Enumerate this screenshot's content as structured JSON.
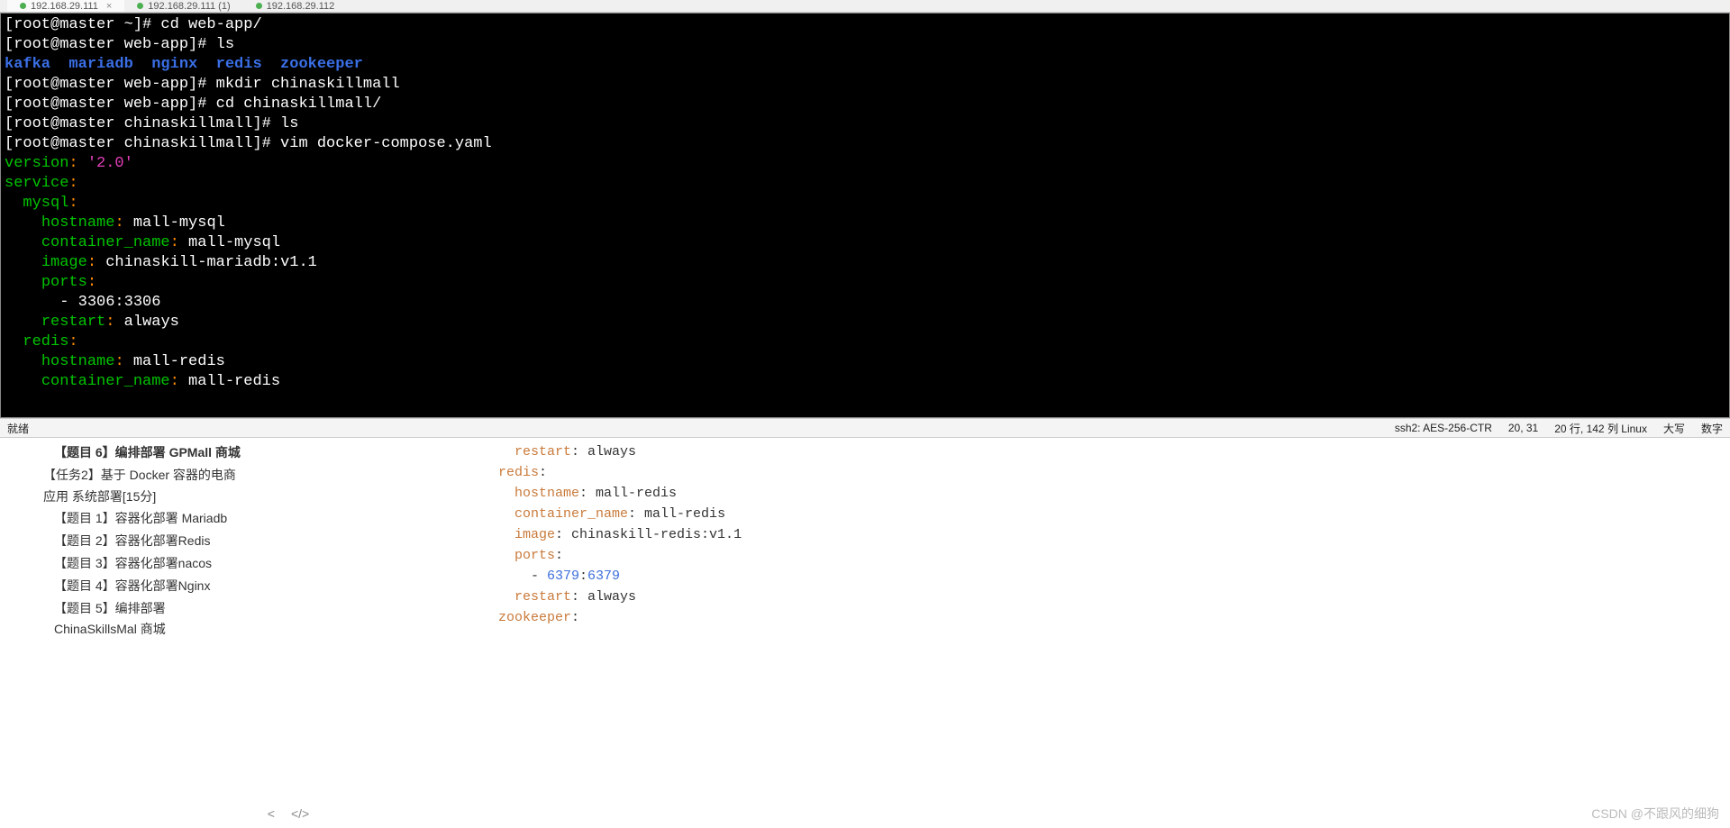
{
  "tabs": [
    {
      "label": "192.168.29.111",
      "active": true,
      "has_close": true,
      "suffix": ""
    },
    {
      "label": "192.168.29.111 (1)",
      "active": false,
      "has_close": false,
      "suffix": ""
    },
    {
      "label": "192.168.29.112",
      "active": false,
      "has_close": false,
      "suffix": ""
    }
  ],
  "terminal_lines": [
    {
      "segs": [
        {
          "c": "t-white",
          "t": "[root@master ~]# cd web-app/"
        }
      ]
    },
    {
      "segs": [
        {
          "c": "t-white",
          "t": "[root@master web-app]# ls"
        }
      ]
    },
    {
      "segs": [
        {
          "c": "t-blue",
          "t": "kafka  mariadb  nginx  redis  zookeeper"
        }
      ]
    },
    {
      "segs": [
        {
          "c": "t-white",
          "t": "[root@master web-app]# mkdir chinaskillmall"
        }
      ]
    },
    {
      "segs": [
        {
          "c": "t-white",
          "t": "[root@master web-app]# cd chinaskillmall/"
        }
      ]
    },
    {
      "segs": [
        {
          "c": "t-white",
          "t": "[root@master chinaskillmall]# ls"
        }
      ]
    },
    {
      "segs": [
        {
          "c": "t-white",
          "t": "[root@master chinaskillmall]# vim docker-compose.yaml"
        }
      ]
    },
    {
      "segs": [
        {
          "c": "t-green",
          "t": "version"
        },
        {
          "c": "t-orange",
          "t": ": "
        },
        {
          "c": "t-magenta",
          "t": "'2.0'"
        }
      ]
    },
    {
      "segs": [
        {
          "c": "t-green",
          "t": "service"
        },
        {
          "c": "t-orange",
          "t": ":"
        }
      ]
    },
    {
      "segs": [
        {
          "c": "t-white",
          "t": "  "
        },
        {
          "c": "t-green",
          "t": "mysql"
        },
        {
          "c": "t-orange",
          "t": ":"
        }
      ]
    },
    {
      "segs": [
        {
          "c": "t-white",
          "t": "    "
        },
        {
          "c": "t-green",
          "t": "hostname"
        },
        {
          "c": "t-orange",
          "t": ":"
        },
        {
          "c": "t-white",
          "t": " mall-mysql"
        }
      ]
    },
    {
      "segs": [
        {
          "c": "t-white",
          "t": "    "
        },
        {
          "c": "t-green",
          "t": "container_name"
        },
        {
          "c": "t-orange",
          "t": ":"
        },
        {
          "c": "t-white",
          "t": " mall-mysql"
        }
      ]
    },
    {
      "segs": [
        {
          "c": "t-white",
          "t": "    "
        },
        {
          "c": "t-green",
          "t": "image"
        },
        {
          "c": "t-orange",
          "t": ":"
        },
        {
          "c": "t-white",
          "t": " chinaskill-mariadb:v1.1"
        }
      ]
    },
    {
      "segs": [
        {
          "c": "t-white",
          "t": "    "
        },
        {
          "c": "t-green",
          "t": "ports"
        },
        {
          "c": "t-orange",
          "t": ":"
        }
      ]
    },
    {
      "segs": [
        {
          "c": "t-white",
          "t": "      - 3306:3306"
        }
      ]
    },
    {
      "segs": [
        {
          "c": "t-white",
          "t": "    "
        },
        {
          "c": "t-green",
          "t": "restart"
        },
        {
          "c": "t-orange",
          "t": ":"
        },
        {
          "c": "t-white",
          "t": " always"
        }
      ]
    },
    {
      "segs": [
        {
          "c": "t-white",
          "t": ""
        }
      ]
    },
    {
      "segs": [
        {
          "c": "t-white",
          "t": "  "
        },
        {
          "c": "t-green",
          "t": "redis"
        },
        {
          "c": "t-orange",
          "t": ":"
        }
      ]
    },
    {
      "segs": [
        {
          "c": "t-white",
          "t": "    "
        },
        {
          "c": "t-green",
          "t": "hostname"
        },
        {
          "c": "t-orange",
          "t": ":"
        },
        {
          "c": "t-white",
          "t": " mall-redis"
        }
      ]
    },
    {
      "segs": [
        {
          "c": "t-white",
          "t": "    "
        },
        {
          "c": "t-green",
          "t": "container_name"
        },
        {
          "c": "t-orange",
          "t": ":"
        },
        {
          "c": "t-white",
          "t": " mall-redis"
        }
      ]
    }
  ],
  "status": {
    "left": "就绪",
    "ssh": "ssh2: AES-256-CTR",
    "pos": "20, 31",
    "size": "20 行, 142 列 ",
    "os": "Linux",
    "caps": "大写",
    "num": "数字"
  },
  "sidebar": [
    {
      "label": "【题目 6】编排部署 GPMall 商城",
      "indent": "indent2",
      "active": true
    },
    {
      "label": "【任务2】基于 Docker 容器的电商应用 系统部署[15分]",
      "indent": "indent1",
      "active": false
    },
    {
      "label": "【题目 1】容器化部署 Mariadb",
      "indent": "indent2",
      "active": false
    },
    {
      "label": "【题目 2】容器化部署Redis",
      "indent": "indent2",
      "active": false
    },
    {
      "label": "【题目 3】容器化部署nacos",
      "indent": "indent2",
      "active": false
    },
    {
      "label": "【题目 4】容器化部署Nginx",
      "indent": "indent2",
      "active": false
    },
    {
      "label": "【题目 5】编排部署 ChinaSkillsMal 商城",
      "indent": "indent2",
      "active": false
    }
  ],
  "gutter": {
    "left": "<",
    "right": ">",
    "code": "</>"
  },
  "content_lines": [
    {
      "segs": [
        {
          "c": "",
          "t": "    "
        },
        {
          "c": "c-orange",
          "t": "restart"
        },
        {
          "c": "",
          "t": ": always"
        }
      ]
    },
    {
      "segs": [
        {
          "c": "",
          "t": ""
        }
      ]
    },
    {
      "segs": [
        {
          "c": "",
          "t": "  "
        },
        {
          "c": "c-orange",
          "t": "redis"
        },
        {
          "c": "",
          "t": ":"
        }
      ]
    },
    {
      "segs": [
        {
          "c": "",
          "t": "    "
        },
        {
          "c": "c-orange",
          "t": "hostname"
        },
        {
          "c": "",
          "t": ": mall-redis"
        }
      ]
    },
    {
      "segs": [
        {
          "c": "",
          "t": "    "
        },
        {
          "c": "c-orange",
          "t": "container_name"
        },
        {
          "c": "",
          "t": ": mall-redis"
        }
      ]
    },
    {
      "segs": [
        {
          "c": "",
          "t": "    "
        },
        {
          "c": "c-orange",
          "t": "image"
        },
        {
          "c": "",
          "t": ": chinaskill-redis:v1.1"
        }
      ]
    },
    {
      "segs": [
        {
          "c": "",
          "t": "    "
        },
        {
          "c": "c-orange",
          "t": "ports"
        },
        {
          "c": "",
          "t": ":"
        }
      ]
    },
    {
      "segs": [
        {
          "c": "",
          "t": "      - "
        },
        {
          "c": "c-blue",
          "t": "6379"
        },
        {
          "c": "",
          "t": ":"
        },
        {
          "c": "c-blue",
          "t": "6379"
        }
      ]
    },
    {
      "segs": [
        {
          "c": "",
          "t": "    "
        },
        {
          "c": "c-orange",
          "t": "restart"
        },
        {
          "c": "",
          "t": ": always"
        }
      ]
    },
    {
      "segs": [
        {
          "c": "",
          "t": ""
        }
      ]
    },
    {
      "segs": [
        {
          "c": "",
          "t": "  "
        },
        {
          "c": "c-orange",
          "t": "zookeeper"
        },
        {
          "c": "",
          "t": ":"
        }
      ]
    }
  ],
  "watermark": "CSDN @不跟风的细狗"
}
